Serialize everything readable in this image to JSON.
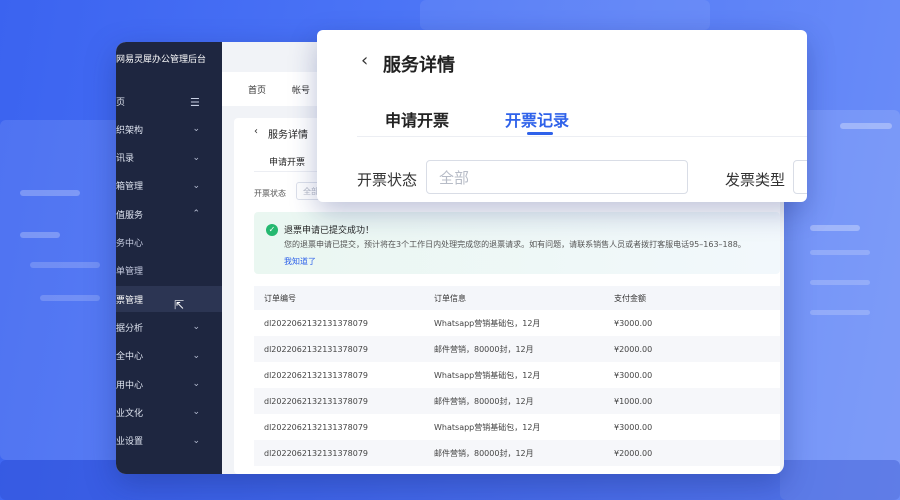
{
  "app": {
    "title": "网易灵犀办公管理后台"
  },
  "sidebar": {
    "items": [
      {
        "label": "页",
        "chev": "",
        "sub": false
      },
      {
        "label": "织架构",
        "chev": "⌄",
        "sub": false
      },
      {
        "label": "讯录",
        "chev": "⌄",
        "sub": false
      },
      {
        "label": "箱管理",
        "chev": "⌄",
        "sub": false
      },
      {
        "label": "值服务",
        "chev": "⌃",
        "sub": false
      },
      {
        "label": "务中心",
        "chev": "",
        "sub": true
      },
      {
        "label": "单管理",
        "chev": "",
        "sub": true
      },
      {
        "label": "票管理",
        "chev": "",
        "sub": true,
        "active": true
      },
      {
        "label": "据分析",
        "chev": "⌄",
        "sub": false
      },
      {
        "label": "全中心",
        "chev": "⌄",
        "sub": false
      },
      {
        "label": "用中心",
        "chev": "⌄",
        "sub": false
      },
      {
        "label": "业文化",
        "chev": "⌄",
        "sub": false
      },
      {
        "label": "业设置",
        "chev": "⌄",
        "sub": false
      }
    ]
  },
  "topbar": {
    "home": "首页",
    "account": "帐号"
  },
  "content": {
    "back": "‹",
    "title": "服务详情",
    "tab_apply": "申请开票",
    "status_label": "开票状态",
    "status_placeholder": "全部"
  },
  "alert": {
    "title": "退票申请已提交成功！",
    "desc": "您的退票申请已提交，预计将在3个工作日内处理完成您的退票请求。如有问题，请联系销售人员或者拨打客服电话95–163–188。",
    "link": "我知道了"
  },
  "table": {
    "headers": [
      "订单编号",
      "订单信息",
      "支付金额"
    ],
    "rows": [
      [
        "dl2022062132131378079",
        "Whatsapp营销基础包，12月",
        "¥3000.00"
      ],
      [
        "dl2022062132131378079",
        "邮件营销，80000封，12月",
        "¥2000.00"
      ],
      [
        "dl2022062132131378079",
        "Whatsapp营销基础包，12月",
        "¥3000.00"
      ],
      [
        "dl2022062132131378079",
        "邮件营销，80000封，12月",
        "¥1000.00"
      ],
      [
        "dl2022062132131378079",
        "Whatsapp营销基础包，12月",
        "¥3000.00"
      ],
      [
        "dl2022062132131378079",
        "邮件营销，80000封，12月",
        "¥2000.00"
      ]
    ]
  },
  "zoom": {
    "back": "‹",
    "title": "服务详情",
    "tab_apply": "申请开票",
    "tab_records": "开票记录",
    "status_label": "开票状态",
    "status_placeholder": "全部",
    "type_label": "发票类型"
  },
  "colors": {
    "accent": "#2f62ea",
    "sidebar": "#1e2640",
    "success": "#25b870"
  }
}
